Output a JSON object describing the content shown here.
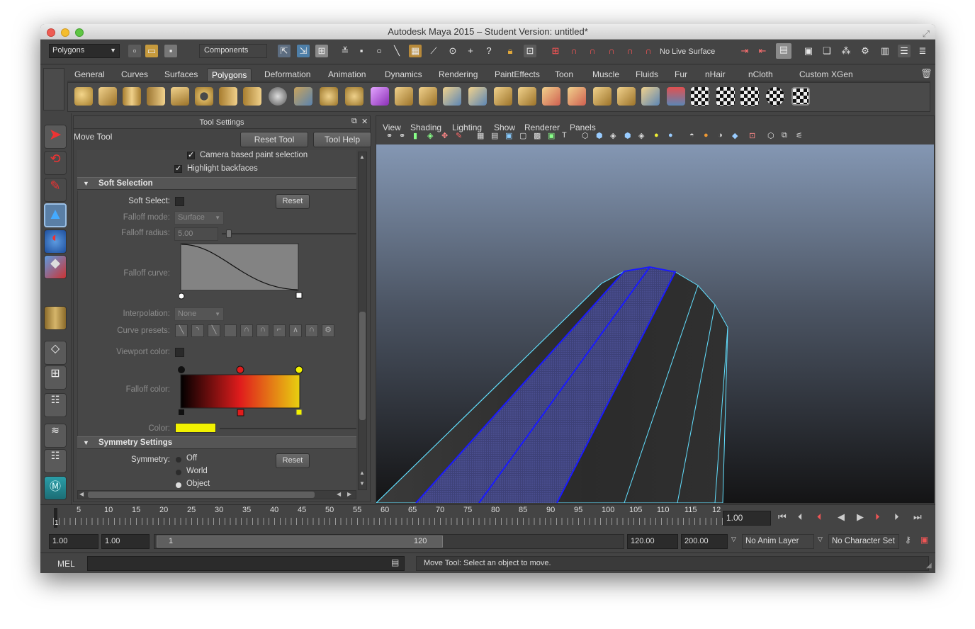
{
  "window": {
    "title": "Autodesk Maya 2015 – Student Version: untitled*"
  },
  "statusline": {
    "menu_set": "Polygons",
    "selection_mode": "Components",
    "live_surface": "No Live Surface"
  },
  "shelf": {
    "tabs": [
      "General",
      "Curves",
      "Surfaces",
      "Polygons",
      "Deformation",
      "Animation",
      "Dynamics",
      "Rendering",
      "PaintEffects",
      "Toon",
      "Muscle",
      "Fluids",
      "Fur",
      "nHair",
      "nCloth",
      "Custom",
      "XGen"
    ],
    "active_tab": "Polygons"
  },
  "tool_settings": {
    "panel_title": "Tool Settings",
    "tool_name": "Move Tool",
    "reset_tool": "Reset Tool",
    "tool_help": "Tool Help",
    "camera_based": "Camera based paint selection",
    "highlight_backfaces": "Highlight backfaces",
    "soft_selection": {
      "header": "Soft Selection",
      "soft_select_label": "Soft Select:",
      "reset": "Reset",
      "falloff_mode_label": "Falloff mode:",
      "falloff_mode_value": "Surface",
      "falloff_radius_label": "Falloff radius:",
      "falloff_radius_value": "5.00",
      "falloff_curve_label": "Falloff curve:",
      "interpolation_label": "Interpolation:",
      "interpolation_value": "None",
      "curve_presets_label": "Curve presets:",
      "viewport_color_label": "Viewport color:",
      "falloff_color_label": "Falloff color:",
      "color_label": "Color:"
    },
    "symmetry": {
      "header": "Symmetry Settings",
      "label": "Symmetry:",
      "reset": "Reset",
      "options": [
        "Off",
        "World",
        "Object"
      ],
      "selected": "Object"
    }
  },
  "viewport": {
    "menus": [
      "View",
      "Shading",
      "Lighting",
      "Show",
      "Renderer",
      "Panels"
    ]
  },
  "timeline": {
    "ticks": [
      "5",
      "10",
      "15",
      "20",
      "25",
      "30",
      "35",
      "40",
      "45",
      "50",
      "55",
      "60",
      "65",
      "70",
      "75",
      "80",
      "85",
      "90",
      "95",
      "100",
      "105",
      "110",
      "115",
      "12"
    ],
    "start_marker": "1",
    "current_frame": "1.00"
  },
  "range": {
    "start": "1.00",
    "playback_start": "1.00",
    "slider_start": "1",
    "slider_end": "120",
    "playback_end": "120.00",
    "end": "200.00",
    "anim_layer": "No Anim Layer",
    "character_set": "No Character Set"
  },
  "command": {
    "language": "MEL",
    "help_line": "Move Tool: Select an object to move."
  },
  "colors": {
    "accent": "#5b8fc2",
    "selected_edge": "#1a1aff",
    "border_edge": "#62e0ff",
    "falloff_color": "#f2f200"
  }
}
